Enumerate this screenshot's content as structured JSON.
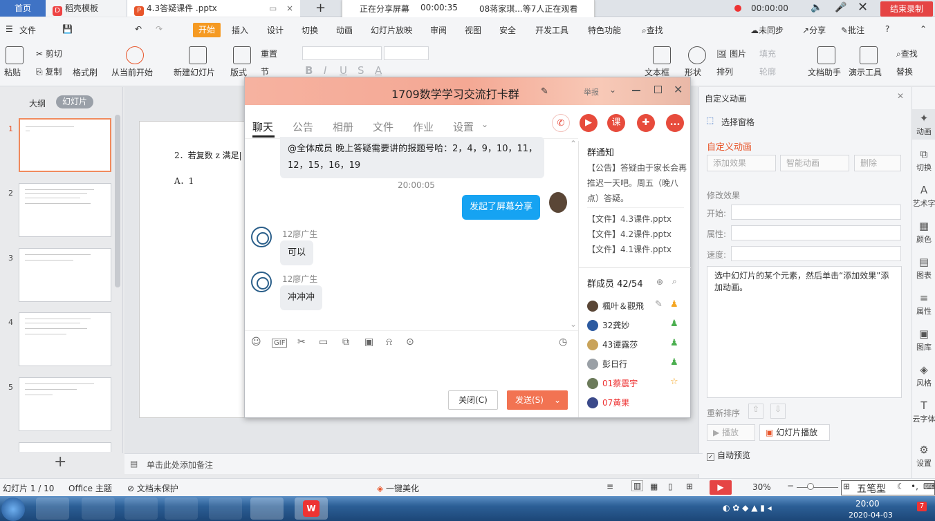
{
  "tabs": {
    "home": "首页",
    "template": "稻壳模板",
    "doc": "4.3答疑课件 .pptx",
    "new": "+"
  },
  "share": {
    "status": "正在分享屏幕",
    "time": "00:00:35",
    "viewers": "08蒋家琪...等7人正在观看"
  },
  "recording": {
    "time": "00:00:00",
    "end_label": "结束录制"
  },
  "menu": {
    "file": "文件",
    "start": "开始",
    "items": [
      "插入",
      "设计",
      "切换",
      "动画",
      "幻灯片放映",
      "审阅",
      "视图",
      "安全",
      "开发工具",
      "特色功能"
    ],
    "search": "查找",
    "sync": "未同步",
    "share": "分享",
    "comment": "批注",
    "help": "?"
  },
  "ribbon": {
    "paste": "粘贴",
    "cut": "剪切",
    "copy": "复制",
    "format_painter": "格式刷",
    "from_start": "从当前开始",
    "new_slide": "新建幻灯片",
    "layout": "版式",
    "reset": "重置",
    "section": "节",
    "textbox": "文本框",
    "shape": "形状",
    "picture": "图片",
    "fill": "填充",
    "arrange": "排列",
    "outline": "轮廓",
    "doc_helper": "文档助手",
    "demo_tools": "演示工具",
    "find": "查找",
    "replace": "替换"
  },
  "left_panel": {
    "tab_outline": "大纲",
    "tab_slides": "幻灯片",
    "slides": [
      "1",
      "2",
      "3",
      "4",
      "5"
    ],
    "add": "+"
  },
  "slide": {
    "line1": "2．若复数 z 满足| z",
    "line2": "A．1"
  },
  "chat": {
    "title": "1709数学学习交流打卡群",
    "header_action": "举报",
    "tabs": [
      "聊天",
      "公告",
      "相册",
      "文件",
      "作业",
      "设置"
    ],
    "msg1": "@全体成员 晚上答疑需要讲的报题号哈：2，4，9，10，11，",
    "msg1b": "12，15，16，19",
    "timestamp": "20:00:05",
    "self_msg": "发起了屏幕分享",
    "sender1": "12廖广生",
    "msg2": "可以",
    "sender2": "12廖广生",
    "msg3": "冲冲冲",
    "close_btn": "关闭(C)",
    "send_btn": "发送(S)",
    "notice_title": "群通知",
    "notice": [
      "【公告】答疑由于家长会再",
      "推迟一天吧。周五（晚八",
      "点）答疑。"
    ],
    "files": [
      "【文件】4.3课件.pptx",
      "【文件】4.2课件.pptx",
      "【文件】4.1课件.pptx"
    ],
    "members_title": "群成员 42/54",
    "members": [
      "楓叶＆觀飛",
      "32龚妙",
      "43谭露莎",
      "彭日行",
      "01蔡震宇",
      "07黄果"
    ],
    "action_icons": {
      "call": "phone-icon",
      "video": "video-icon",
      "class": "课",
      "msg": "chat-icon",
      "more": "..."
    }
  },
  "right_panel": {
    "title": "自定义动画",
    "select_pane": "选择窗格",
    "custom_anim": "自定义动画",
    "add_effect": "添加效果",
    "smart_anim": "智能动画",
    "delete": "删除",
    "modify": "修改效果",
    "start": "开始:",
    "property": "属性:",
    "speed": "速度:",
    "hint": "选中幻灯片的某个元素，然后单击“添加效果”添加动画。",
    "reorder": "重新排序",
    "play": "播放",
    "slideshow": "幻灯片播放",
    "autopreview": "自动预览"
  },
  "sidebar": [
    "动画",
    "切换",
    "艺术字",
    "颜色",
    "图表",
    "属性",
    "图库",
    "风格",
    "云字体",
    "设置"
  ],
  "notes": "单击此处添加备注",
  "status": {
    "slide": "幻灯片 1 / 10",
    "theme": "Office 主题",
    "protect": "文档未保护",
    "beautify": "一键美化",
    "zoom": "30%"
  },
  "taskbar": {
    "ime": "五笔型",
    "clock_time": "20:00",
    "clock_date": "2020-04-03",
    "notif": "7"
  }
}
